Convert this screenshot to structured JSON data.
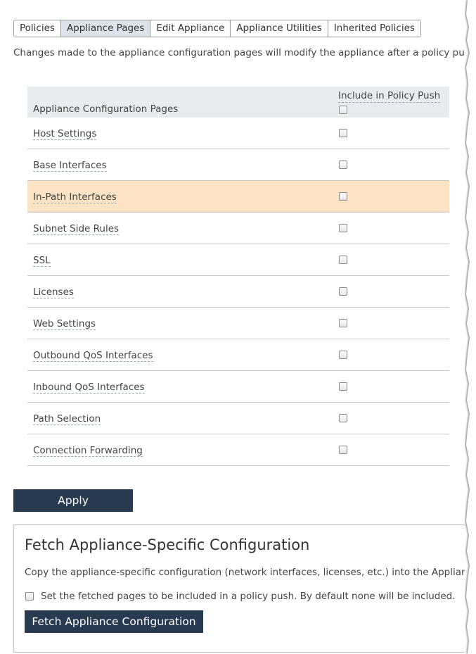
{
  "tabs": [
    {
      "label": "Policies",
      "active": false
    },
    {
      "label": "Appliance Pages",
      "active": true
    },
    {
      "label": "Edit Appliance",
      "active": false
    },
    {
      "label": "Appliance Utilities",
      "active": false
    },
    {
      "label": "Inherited Policies",
      "active": false
    }
  ],
  "intro_text": "Changes made to the appliance configuration pages will modify the appliance after a policy push.",
  "table": {
    "header_name": "Appliance Configuration Pages",
    "header_include": "Include in Policy Push",
    "rows": [
      {
        "label": "Host Settings",
        "checked": false
      },
      {
        "label": "Base Interfaces",
        "checked": false
      },
      {
        "label": "In-Path Interfaces",
        "checked": false,
        "highlighted": true
      },
      {
        "label": "Subnet Side Rules",
        "checked": false
      },
      {
        "label": "SSL",
        "checked": false
      },
      {
        "label": "Licenses",
        "checked": false
      },
      {
        "label": "Web Settings",
        "checked": false
      },
      {
        "label": "Outbound QoS Interfaces",
        "checked": false
      },
      {
        "label": "Inbound QoS Interfaces",
        "checked": false
      },
      {
        "label": "Path Selection",
        "checked": false
      },
      {
        "label": "Connection Forwarding",
        "checked": false
      }
    ]
  },
  "apply_label": "Apply",
  "fetch": {
    "title": "Fetch Appliance-Specific Configuration",
    "description": "Copy the appliance-specific configuration (network interfaces, licenses, etc.) into the Appliance Pa",
    "option_label": "Set the fetched pages to be included in a policy push. By default none will be included.",
    "button_label": "Fetch Appliance Configuration"
  },
  "colors": {
    "button_bg": "#283a50",
    "active_tab_bg": "#dde3ea",
    "highlight_row": "#fbe3c3",
    "table_header_bg": "#e9ecef"
  }
}
